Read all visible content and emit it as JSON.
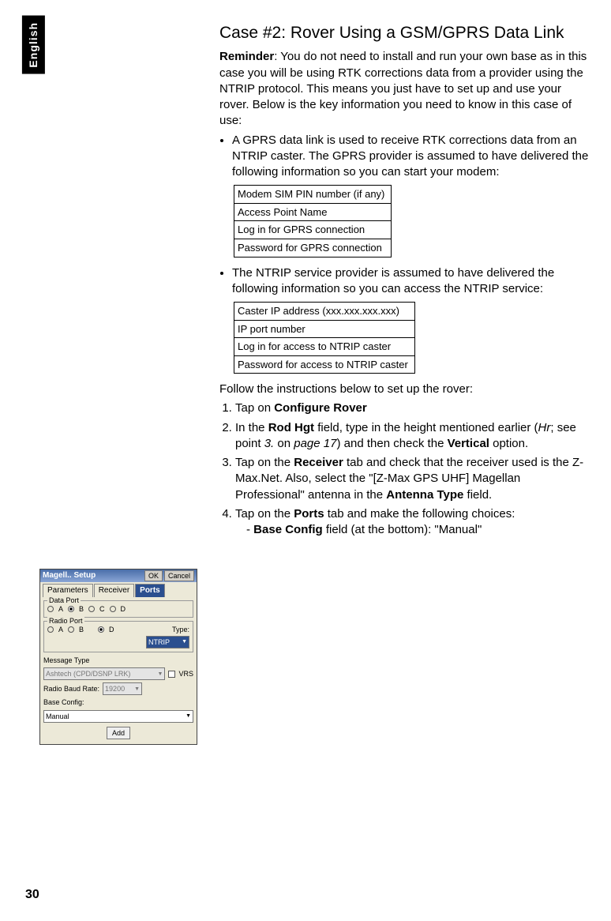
{
  "side_tab": "English",
  "page_number": "30",
  "heading": "Case #2: Rover Using a GSM/GPRS Data Link",
  "reminder_label": "Reminder",
  "reminder_text": ": You do not need to install and run your own base as in this case you will be using RTK corrections data from a provider using the NTRIP protocol. This means you just have to set up and use your rover. Below is the key information you need to know in this case of use:",
  "bullet1": "A GPRS data link is used to receive RTK corrections data from an NTRIP caster. The GPRS provider is assumed to have delivered the following information so you can start your modem:",
  "table1": {
    "r1": "Modem SIM PIN number (if any)",
    "r2": "Access Point Name",
    "r3": "Log in for GPRS connection",
    "r4": "Password for GPRS connection"
  },
  "bullet2": "The NTRIP service provider is assumed to have delivered the following information so you can access the NTRIP service:",
  "table2": {
    "r1": "Caster IP address (xxx.xxx.xxx.xxx)",
    "r2": "IP port number",
    "r3": "Log in for access to NTRIP caster",
    "r4": "Password for access to NTRIP caster"
  },
  "instructions_intro": "Follow the instructions below to set up the rover:",
  "step1_pre": "Tap on ",
  "step1_b": "Configure Rover",
  "step2_pre": "In the ",
  "step2_b1": "Rod Hgt",
  "step2_mid1": " field, type in the height mentioned earlier (",
  "step2_i1": "Hr",
  "step2_mid2": "; see point ",
  "step2_i2": "3.",
  "step2_mid3": " on ",
  "step2_i3": "page 17",
  "step2_mid4": ") and then check the ",
  "step2_b2": "Vertical",
  "step2_end": " option.",
  "step3_pre": "Tap on the ",
  "step3_b1": "Receiver",
  "step3_mid1": " tab and check that the receiver used is the Z-Max.Net. Also, select the \"[Z-Max GPS UHF] Magellan Professional\" antenna in the ",
  "step3_b2": "Antenna Type",
  "step3_end": " field.",
  "step4_pre": "Tap on the ",
  "step4_b1": "Ports",
  "step4_end": " tab and make the following choices:",
  "step4_sub_pre": "- ",
  "step4_sub_b": "Base Config",
  "step4_sub_end": " field (at the bottom): \"Manual\"",
  "fig": {
    "title": "Magell.. Setup",
    "ok": "OK",
    "cancel": "Cancel",
    "tab1": "Parameters",
    "tab2": "Receiver",
    "tab3": "Ports",
    "group_data": "Data Port",
    "rA": "A",
    "rB": "B",
    "rC": "C",
    "rD": "D",
    "group_radio": "Radio Port",
    "type_lbl": "Type:",
    "type_val": "NTRIP",
    "msg_lbl": "Message Type",
    "msg_val": "Ashtech (CPD/DSNP LRK)",
    "vrs": "VRS",
    "baud_lbl": "Radio Baud Rate:",
    "baud_val": "19200",
    "base_lbl": "Base Config:",
    "base_val": "Manual",
    "add": "Add"
  }
}
